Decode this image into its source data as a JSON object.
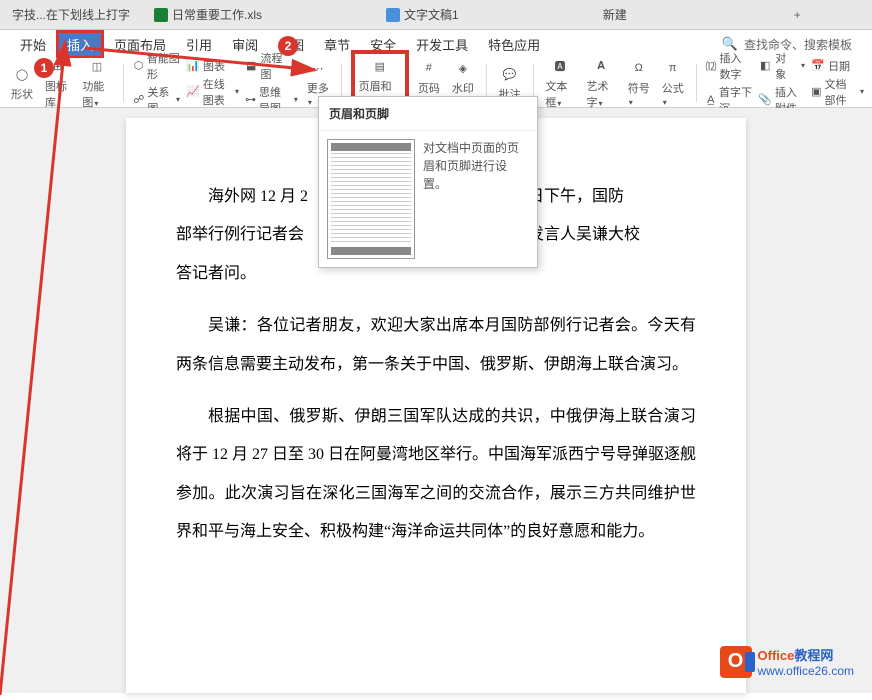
{
  "tabs": {
    "tab1": "字技...在下划线上打字",
    "tab2": "日常重要工作.xls",
    "tab3": "文字文稿1",
    "tab4": "新建",
    "plus": "+"
  },
  "menu": {
    "start": "开始",
    "insert": "插入",
    "layout": "页面布局",
    "reference": "引用",
    "review": "审阅",
    "view": "视图",
    "section": "章节",
    "security": "安全",
    "dev": "开发工具",
    "special": "特色应用"
  },
  "search": {
    "find": "查找命令、搜索模板",
    "icon": "🔍"
  },
  "ribbon": {
    "shape": "形状",
    "iconlib": "图标库",
    "funcimg": "功能图",
    "smartshape": "智能图形",
    "chart": "图表",
    "relchart": "关系图",
    "onlinechart": "在线图表",
    "flowchart": "流程图",
    "mindmap": "思维导图",
    "more": "更多",
    "headerfooter": "页眉和页脚",
    "pagenum": "页码",
    "watermark": "水印",
    "comment": "批注",
    "textbox": "文本框",
    "wordart": "艺术字",
    "symbol": "符号",
    "formula": "公式",
    "insertnum": "插入数字",
    "firstcap": "首字下沉",
    "object": "对象",
    "insertattach": "插入附件",
    "date": "日期",
    "docparts": "文档部件"
  },
  "callouts": {
    "one": "1",
    "two": "2"
  },
  "tooltip": {
    "title": "页眉和页脚",
    "desc": "对文档中页面的页眉和页脚进行设置。"
  },
  "doc": {
    "p1": "海外网 12 月 26 日下午，国防部举行例行记者会新闻发言人吴谦大校答记者问。",
    "p1_a": "海外网 12 月 2",
    "p1_b": "2 月 26 日下午，国防",
    "p1_c": "部举行例行记者会",
    "p1_d": "新闻发言人吴谦大校",
    "p1_e": "答记者问。",
    "p2": "吴谦：各位记者朋友，欢迎大家出席本月国防部例行记者会。今天有两条信息需要主动发布，第一条关于中国、俄罗斯、伊朗海上联合演习。",
    "p3": "根据中国、俄罗斯、伊朗三国军队达成的共识，中俄伊海上联合演习将于 12 月 27 日至 30 日在阿曼湾地区举行。中国海军派西宁号导弹驱逐舰参加。此次演习旨在深化三国海军之间的交流合作，展示三方共同维护世界和平与海上安全、积极构建“海洋命运共同体”的良好意愿和能力。"
  },
  "watermark_logo": {
    "title_prefix": "Office",
    "title_suffix": "教程网",
    "url": "www.office26.com"
  }
}
